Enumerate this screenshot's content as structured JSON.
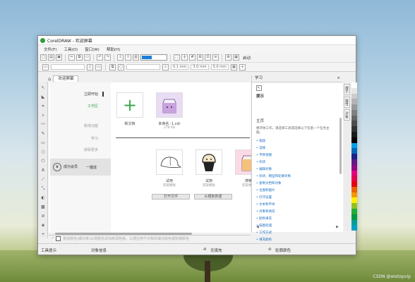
{
  "window": {
    "title": "CorelDRAW - 欢迎屏幕"
  },
  "menu": [
    "文件(F)",
    "工具(O)",
    "窗口(W)",
    "帮助(H)"
  ],
  "toolbar": {
    "launch_label": "启动"
  },
  "propertybar": {
    "units": [
      "3.0 mm",
      "5.0 mm"
    ],
    "nudge": "0.1 mm"
  },
  "tabs": {
    "welcome": "欢迎屏幕"
  },
  "welcome": {
    "nav": [
      "立即开始",
      "工作区",
      "新增功能",
      "学习",
      "获取更多"
    ],
    "promo": {
      "line1": "成为会员",
      "line2": "成为会员",
      "link": "一键成"
    },
    "new_doc": "新文档",
    "recent": {
      "name": "未命名 -1.cdr",
      "size": "278 KB"
    },
    "templates": [
      {
        "name": "试用",
        "sub": "获取模板"
      },
      {
        "name": "试用",
        "sub": "获取模板"
      },
      {
        "name": "搜索",
        "sub": "获取更多"
      }
    ],
    "open_button": "打开文件",
    "from_template_button": "从模板新建"
  },
  "docker": {
    "tab_title": "学习",
    "hint_title": "提示",
    "section": "主页",
    "description": "要开始工作，请选择工具或选择以下任意一个任务主题。",
    "links": [
      "缩放",
      "选择",
      "平移视图",
      "形状",
      "编辑对象",
      "形状、模型和轮廓对象",
      "复制文档和对象",
      "位图和图片",
      "打印设置",
      "文本和字体",
      "对象和填充",
      "颜色填充",
      "描图处理",
      "工作方式",
      "填充颜色"
    ]
  },
  "side_tabs": [
    "提示",
    "属性",
    "对象"
  ],
  "palette": [
    "#ffffff",
    "#e6e6e6",
    "#cccccc",
    "#b3b3b3",
    "#999999",
    "#808080",
    "#666666",
    "#4d4d4d",
    "#333333",
    "#1a1a1a",
    "#000000",
    "#00a0e9",
    "#0068b7",
    "#1d2088",
    "#601986",
    "#920783",
    "#e4007f",
    "#e5004f",
    "#e60012",
    "#eb6100",
    "#f39800",
    "#fff100",
    "#8fc31f",
    "#22ac38",
    "#009944",
    "#009e96",
    "#00a0c1"
  ],
  "bottombar": {
    "hint": "拖动颜色(或对象)以将颜色添加到调色板，以便应用于对象的填充颜色或轮廓颜色"
  },
  "status": {
    "tool": "工具提示",
    "info": "对象信息",
    "fill": "无填充",
    "outline": "轮廓颜色"
  },
  "watermark": "CSDN @wistopvip"
}
